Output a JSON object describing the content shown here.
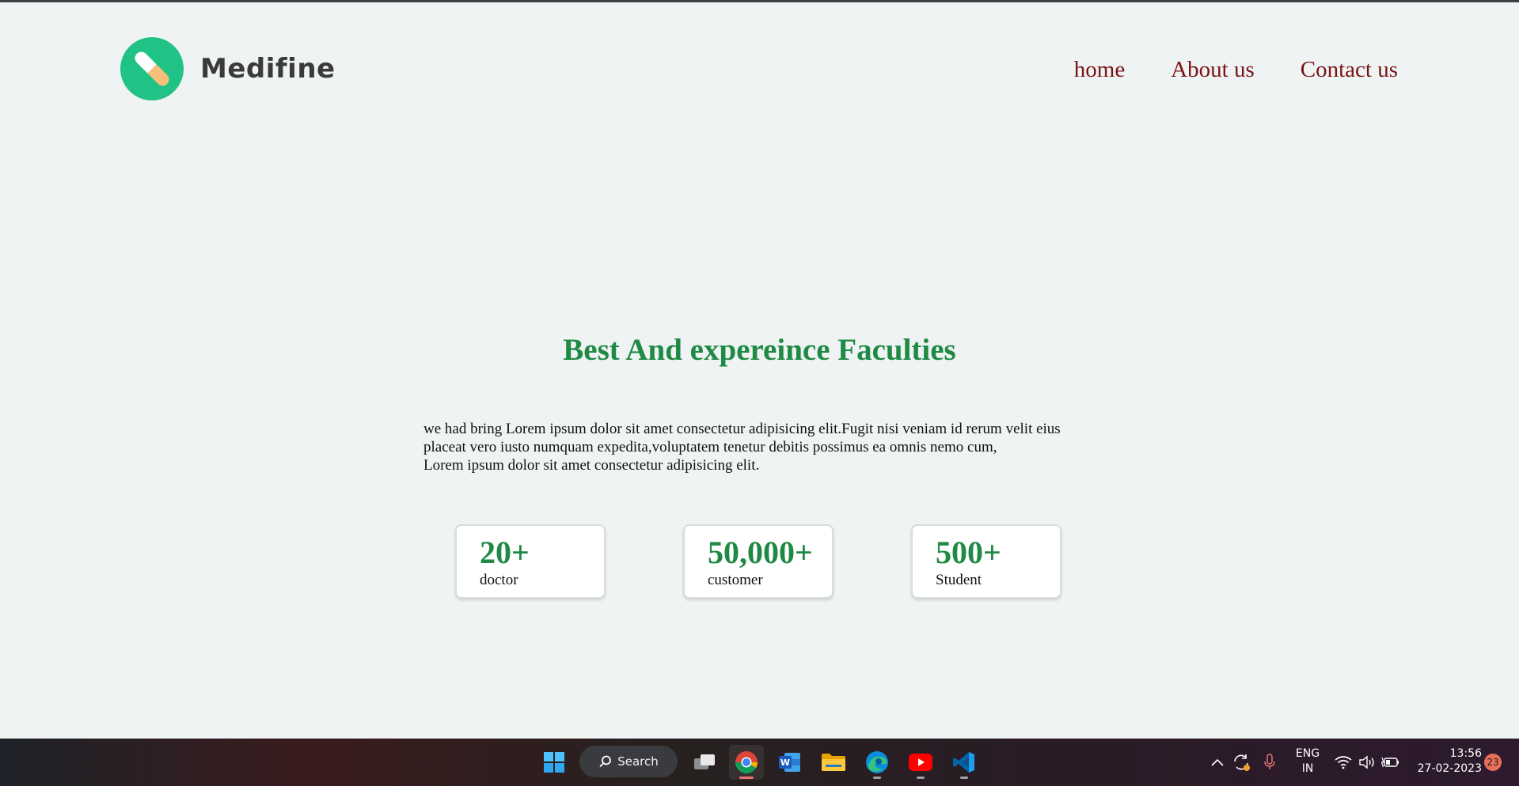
{
  "brand": {
    "name": "Medifine",
    "accent": "#21c286"
  },
  "nav": {
    "items": [
      "home",
      "About us",
      "Contact us"
    ],
    "color": "#7a1212"
  },
  "hero": {
    "heading": "Best And expereince Faculties",
    "heading_color": "#1e8a44",
    "paragraph_lines": [
      "we had bring Lorem ipsum dolor sit amet consectetur adipisicing elit.Fugit nisi veniam id rerum velit eius",
      "placeat vero iusto numquam expedita,voluptatem tenetur debitis possimus ea omnis nemo cum,",
      "Lorem ipsum dolor sit amet consectetur adipisicing elit."
    ]
  },
  "stats": [
    {
      "value": "20+",
      "label": "doctor"
    },
    {
      "value": "50,000+",
      "label": "customer"
    },
    {
      "value": "500+",
      "label": "Student"
    }
  ],
  "taskbar": {
    "search_label": "Search",
    "apps": [
      "windows-start-icon",
      "task-view-icon",
      "chrome-icon",
      "word-icon",
      "file-explorer-icon",
      "edge-icon",
      "youtube-icon",
      "vscode-icon"
    ],
    "language": {
      "line1": "ENG",
      "line2": "IN"
    },
    "time": "13:56",
    "date": "27-02-2023",
    "notification_count": "23"
  }
}
